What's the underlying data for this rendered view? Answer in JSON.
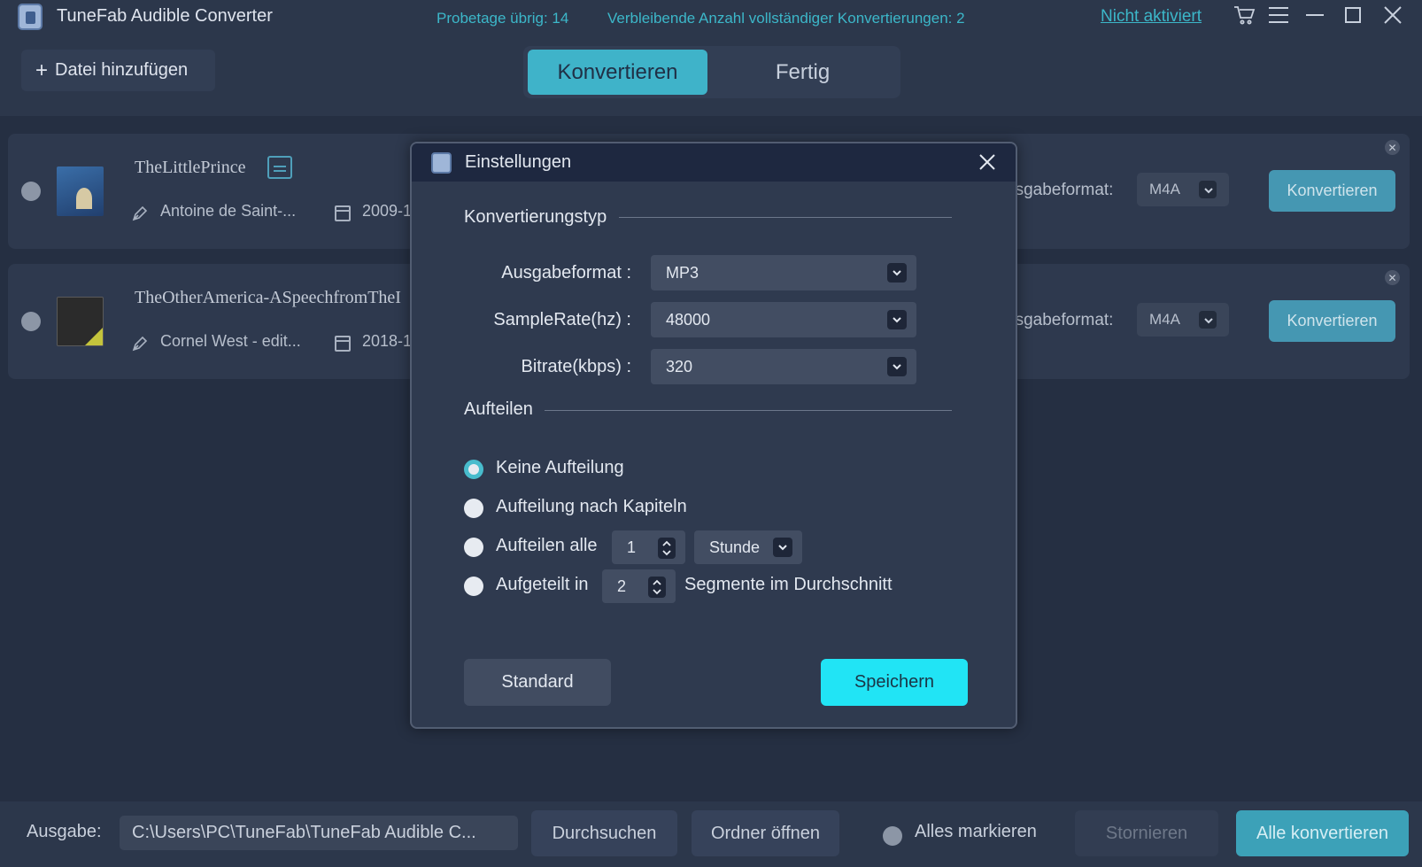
{
  "app": {
    "title": "TuneFab Audible Converter",
    "trial_days": "Probetage übrig: 14",
    "remaining_conversions": "Verbleibende Anzahl vollständiger Konvertierungen: 2",
    "not_activated": "Nicht aktiviert"
  },
  "toolbar": {
    "add_file": "Datei hinzufügen"
  },
  "tabs": [
    {
      "label": "Konvertieren",
      "active": true
    },
    {
      "label": "Fertig",
      "active": false
    }
  ],
  "books": [
    {
      "title": "TheLittlePrince",
      "author": "Antoine de Saint-...",
      "date": "2009-1",
      "format_label": "usgabeformat:",
      "format": "M4A",
      "convert_label": "Konvertieren"
    },
    {
      "title": "TheOtherAmerica-ASpeechfromTheI",
      "author": "Cornel West - edit...",
      "date": "2018-1",
      "format_label": "usgabeformat:",
      "format": "M4A",
      "convert_label": "Konvertieren"
    }
  ],
  "settings": {
    "title": "Einstellungen",
    "conversion_type_heading": "Konvertierungstyp",
    "output_format_label": "Ausgabeformat :",
    "output_format_value": "MP3",
    "samplerate_label": "SampleRate(hz) :",
    "samplerate_value": "48000",
    "bitrate_label": "Bitrate(kbps) :",
    "bitrate_value": "320",
    "split_heading": "Aufteilen",
    "options": {
      "no_split": "Keine Aufteilung",
      "by_chapter": "Aufteilung nach Kapiteln",
      "every": "Aufteilen alle",
      "every_value": "1",
      "every_unit": "Stunde",
      "split_into": "Aufgeteilt in",
      "split_into_value": "2",
      "segments_suffix": "Segmente im Durchschnitt"
    },
    "selected_option": "no_split",
    "default_button": "Standard",
    "save_button": "Speichern"
  },
  "footer": {
    "output_label": "Ausgabe:",
    "output_path": "C:\\Users\\PC\\TuneFab\\TuneFab Audible C...",
    "browse": "Durchsuchen",
    "open_folder": "Ordner öffnen",
    "select_all": "Alles markieren",
    "cancel": "Stornieren",
    "convert_all": "Alle konvertieren"
  },
  "colors": {
    "accent": "#3fb3c9",
    "save_button": "#21e4f5",
    "background": "#252f42",
    "panel": "#2f3a4f"
  },
  "icons": [
    "app-logo-icon",
    "cart-icon",
    "menu-icon",
    "minimize-icon",
    "maximize-icon",
    "close-icon",
    "plus-icon",
    "subtitle-icon",
    "pen-icon",
    "calendar-icon",
    "chevron-down-icon",
    "spinner-icon"
  ]
}
